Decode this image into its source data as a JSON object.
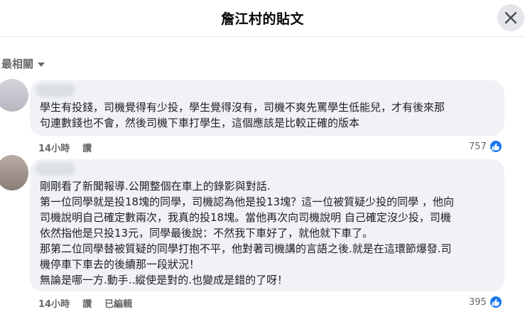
{
  "header": {
    "title": "詹江村的貼文"
  },
  "sort": {
    "label": "最相關"
  },
  "comments": [
    {
      "lines": [
        "學生有投錢，司機覺得有少投，學生覺得沒有，司機不爽先罵學生低能兒，才有後來那",
        "句連數錢也不會，然後司機下車打學生，這個應該是比較正確的版本"
      ],
      "time": "14小時",
      "like_label": "讚",
      "reactions": "757"
    },
    {
      "lines": [
        "剛剛看了新聞報導.公開整個在車上的錄影與對話.",
        "第一位同學就是投18塊的同學，司機認為他是投13塊？這一位被質疑少投的同學 ，他向",
        "司機說明自己確定數兩次，我真的投18塊。當他再次向司機說明 自己確定沒少投，司機",
        "依然指他是只投13元，同學最後說：不然我下車好了，就他就下車了。",
        "那第二位同學替被質疑的同學打抱不平，他對著司機講的言語之後.就是在這環節爆發.司",
        "機停車下車去的後續那一段狀況！",
        "無論是哪一方.動手..縱使是對的.也變成是錯的了呀！"
      ],
      "time": "14小時",
      "like_label": "讚",
      "edited_label": "已編輯",
      "reactions": "395"
    }
  ]
}
